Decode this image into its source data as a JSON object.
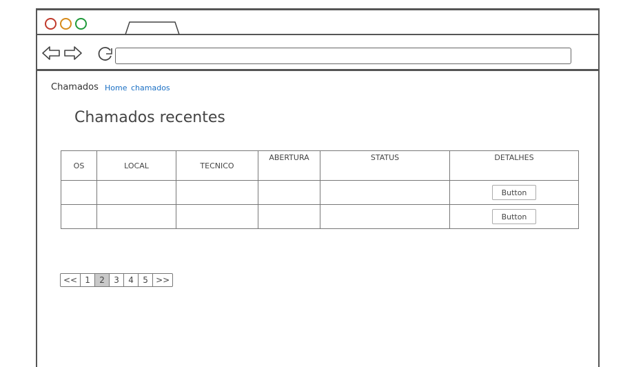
{
  "browser": {
    "url": ""
  },
  "breadcrumb": {
    "app": "Chamados",
    "home": "Home",
    "chamados": "chamados"
  },
  "page": {
    "title": "Chamados recentes"
  },
  "table": {
    "headers": [
      "OS",
      "LOCAL",
      "TECNICO",
      "ABERTURA",
      "STATUS",
      "DETALHES"
    ],
    "rows": [
      {
        "os": "",
        "local": "",
        "tecnico": "",
        "abertura": "",
        "status": "",
        "button": "Button"
      },
      {
        "os": "",
        "local": "",
        "tecnico": "",
        "abertura": "",
        "status": "",
        "button": "Button"
      }
    ]
  },
  "pagination": {
    "first": "<<",
    "pages": [
      "1",
      "2",
      "3",
      "4",
      "5"
    ],
    "active_page": "2",
    "last": ">>"
  }
}
